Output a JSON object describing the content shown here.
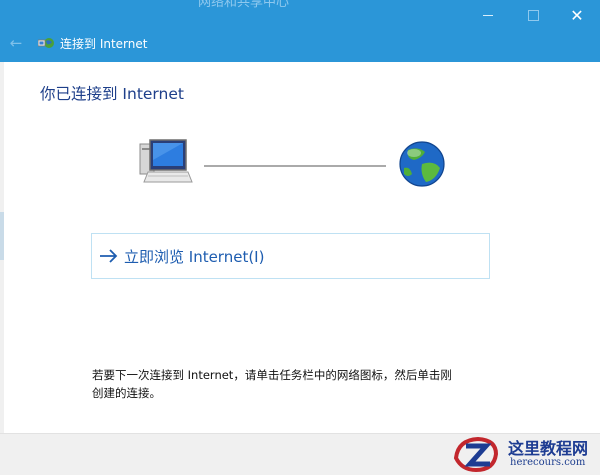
{
  "window": {
    "title_partial": "网络和共享中心",
    "wizard_title": "连接到 Internet",
    "close_glyph": "✕"
  },
  "content": {
    "heading": "你已连接到 Internet",
    "browse_label": "立即浏览 Internet(I)",
    "note": "若要下一次连接到 Internet，请单击任务栏中的网络图标，然后单击刚创建的连接。"
  },
  "watermark": {
    "title": "这里教程网",
    "subtitle": "herecours.com"
  },
  "icons": {
    "back": "back-arrow-icon",
    "wizard": "network-wizard-icon",
    "computer": "computer-icon",
    "globe": "globe-icon",
    "browse": "right-arrow-icon"
  },
  "colors": {
    "titlebar": "#2b96d8",
    "heading": "#1e3f8a",
    "link": "#1e5db0"
  }
}
